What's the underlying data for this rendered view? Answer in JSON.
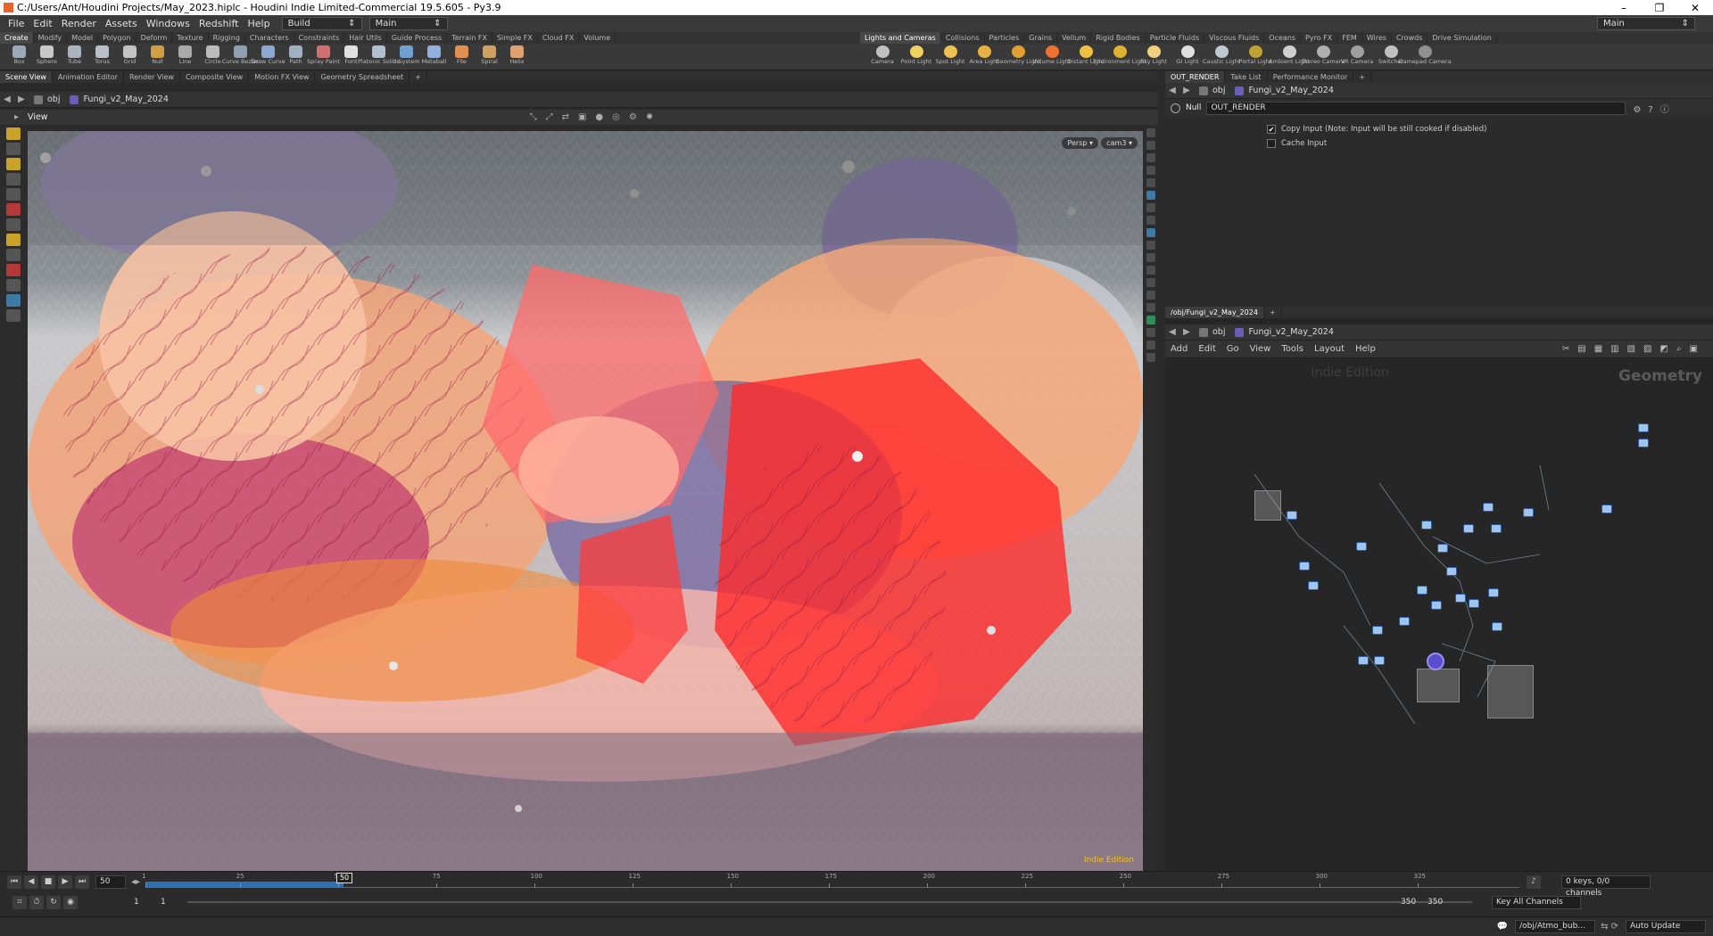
{
  "window": {
    "title": "C:/Users/Ant/Houdini Projects/May_2023.hiplc - Houdini Indie Limited-Commercial 19.5.605 - Py3.9"
  },
  "menu": {
    "items": [
      "File",
      "Edit",
      "Render",
      "Assets",
      "Windows",
      "Redshift",
      "Help"
    ],
    "desktop": "Build",
    "desk_right": "Main",
    "main_dropdown": "Main"
  },
  "shelf": {
    "left_tabs": [
      "Create",
      "Modify",
      "Model",
      "Polygon",
      "Deform",
      "Texture",
      "Rigging",
      "Characters",
      "Constraints",
      "Hair Utils",
      "Guide Process",
      "Terrain FX",
      "Simple FX",
      "Cloud FX",
      "Volume"
    ],
    "right_tabs": [
      "Lights and Cameras",
      "Collisions",
      "Particles",
      "Grains",
      "Vellum",
      "Rigid Bodies",
      "Particle Fluids",
      "Viscous Fluids",
      "Oceans",
      "Pyro FX",
      "FEM",
      "Wires",
      "Crowds",
      "Drive Simulation"
    ],
    "left_tools": [
      "Box",
      "Sphere",
      "Tube",
      "Torus",
      "Grid",
      "Null",
      "Line",
      "Circle",
      "Curve Bezier",
      "Draw Curve",
      "Path",
      "Spray Paint",
      "Font",
      "Platonic Solids",
      "L-System",
      "Metaball",
      "File",
      "Spiral",
      "Helix"
    ],
    "right_tools": [
      "Camera",
      "Point Light",
      "Spot Light",
      "Area Light",
      "Geometry Light",
      "Volume Light",
      "Distant Light",
      "Environment Light",
      "Sky Light",
      "GI Light",
      "Caustic Light",
      "Portal Light",
      "Ambient Light",
      "Stereo Camera",
      "VR Camera",
      "Switcher",
      "Gamepad Camera"
    ]
  },
  "left_pane": {
    "tabs": [
      "Scene View",
      "Animation Editor",
      "Render View",
      "Composite View",
      "Motion FX View",
      "Geometry Spreadsheet"
    ],
    "path": [
      "obj",
      "Fungi_v2_May_2024"
    ],
    "view_label": "View",
    "persp": "Persp",
    "cam": "cam3",
    "indie": "Indie Edition"
  },
  "param_pane": {
    "tabs": [
      "OUT_RENDER",
      "Take List",
      "Performance Monitor"
    ],
    "path": [
      "obj",
      "Fungi_v2_May_2024"
    ],
    "node_type": "Null",
    "node_name": "OUT_RENDER",
    "params": [
      {
        "label": "Copy Input (Note: Input will be still cooked if disabled)",
        "checked": true
      },
      {
        "label": "Cache Input",
        "checked": false
      }
    ]
  },
  "network_pane": {
    "tab": "/obj/Fungi_v2_May_2024",
    "path": [
      "obj",
      "Fungi_v2_May_2024"
    ],
    "menu": [
      "Add",
      "Edit",
      "Go",
      "View",
      "Tools",
      "Layout",
      "Help"
    ],
    "watermark": "Indie Edition",
    "context_label": "Geometry"
  },
  "timeline": {
    "current_frame": "50",
    "marker": "50",
    "ticks": [
      "1",
      "25",
      "50",
      "75",
      "100",
      "125",
      "150",
      "175",
      "200",
      "225",
      "250",
      "275",
      "300",
      "325"
    ],
    "start": "1",
    "start2": "1",
    "end": "350",
    "end2": "350",
    "keys_info": "0 keys, 0/0 channels",
    "key_all": "Key All Channels",
    "fps": ""
  },
  "status": {
    "path": "/obj/Atmo_bub...",
    "update_mode": "Auto Update"
  }
}
